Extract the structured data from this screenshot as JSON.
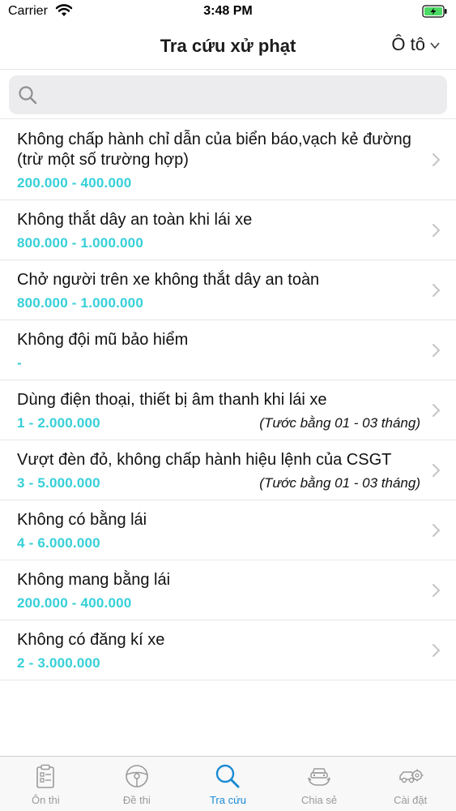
{
  "status": {
    "carrier": "Carrier",
    "time": "3:48 PM"
  },
  "nav": {
    "title": "Tra cứu xử phạt",
    "vehicle_label": "Ô tô"
  },
  "search": {
    "placeholder": ""
  },
  "violations": [
    {
      "title": "Không chấp hành chỉ dẫn của biển báo,vạch kẻ đường (trừ một số trường hợp)",
      "fine": "200.000 - 400.000",
      "note": ""
    },
    {
      "title": "Không thắt dây an toàn khi lái xe",
      "fine": "800.000 - 1.000.000",
      "note": ""
    },
    {
      "title": "Chở người trên xe không thắt dây an toàn",
      "fine": "800.000 - 1.000.000",
      "note": ""
    },
    {
      "title": "Không đội mũ bảo hiểm",
      "fine": "-",
      "note": ""
    },
    {
      "title": "Dùng điện thoại, thiết bị âm thanh khi lái xe",
      "fine": "1 - 2.000.000",
      "note": "(Tước bằng 01 - 03 tháng)"
    },
    {
      "title": "Vượt đèn đỏ, không chấp hành hiệu lệnh của CSGT",
      "fine": "3 - 5.000.000",
      "note": "(Tước bằng 01 - 03 tháng)"
    },
    {
      "title": "Không có bằng lái",
      "fine": "4 - 6.000.000",
      "note": ""
    },
    {
      "title": "Không mang bằng lái",
      "fine": "200.000 - 400.000",
      "note": ""
    },
    {
      "title": "Không có đăng kí xe",
      "fine": "2 - 3.000.000",
      "note": ""
    }
  ],
  "tabs": [
    {
      "label": "Ôn thi",
      "icon": "clipboard-icon",
      "active": false
    },
    {
      "label": "Đề thi",
      "icon": "steering-wheel-icon",
      "active": false
    },
    {
      "label": "Tra cứu",
      "icon": "search-icon",
      "active": true
    },
    {
      "label": "Chia sẻ",
      "icon": "share-car-icon",
      "active": false
    },
    {
      "label": "Cài đặt",
      "icon": "car-settings-icon",
      "active": false
    }
  ],
  "colors": {
    "accent": "#1a8ad4",
    "fine": "#35d0d8",
    "battery": "#4cd964"
  }
}
